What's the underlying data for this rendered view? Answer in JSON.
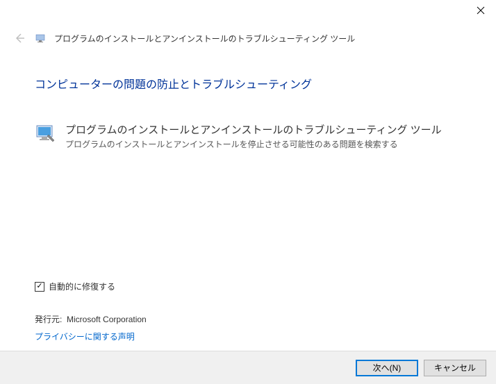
{
  "header": {
    "title": "プログラムのインストールとアンインストールのトラブルシューティング ツール"
  },
  "main": {
    "heading": "コンピューターの問題の防止とトラブルシューティング",
    "tool": {
      "title": "プログラムのインストールとアンインストールのトラブルシューティング ツール",
      "description": "プログラムのインストールとアンインストールを停止させる可能性のある問題を検索する"
    }
  },
  "options": {
    "auto_repair_label": "自動的に修復する",
    "auto_repair_checked": true
  },
  "publisher": {
    "label": "発行元:",
    "name": "Microsoft Corporation"
  },
  "links": {
    "privacy": "プライバシーに関する声明"
  },
  "buttons": {
    "next": "次へ(N)",
    "cancel": "キャンセル"
  }
}
